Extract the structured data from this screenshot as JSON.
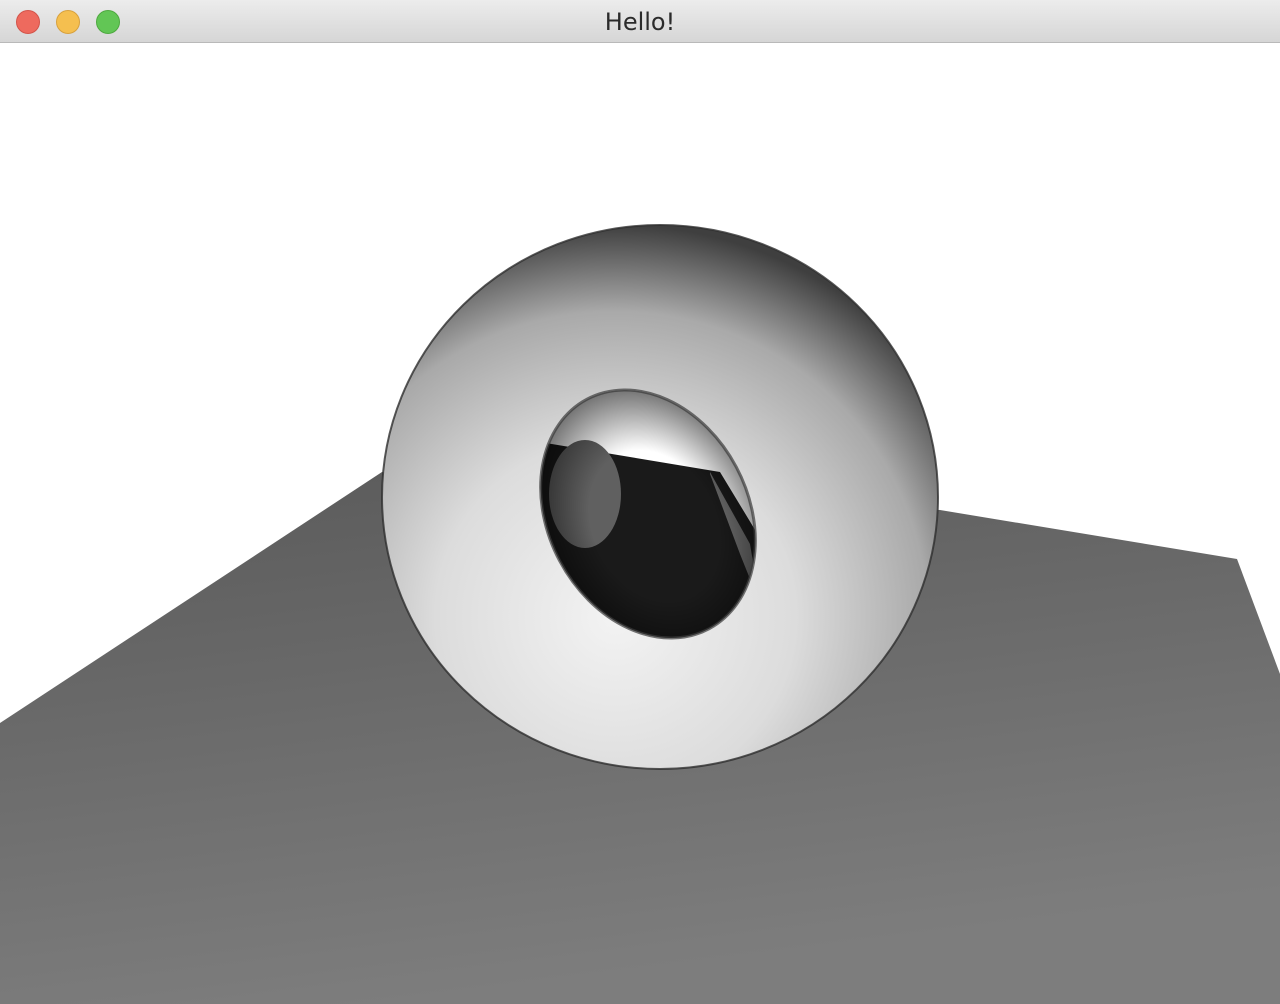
{
  "window": {
    "title": "Hello!"
  },
  "scene": {
    "background_color": "#ffffff",
    "floor_color": "#6a6a6a",
    "torus_highlight_color": "#f0f0f0",
    "torus_shadow_color": "#111111",
    "shadow_color": "#1a1a1a"
  }
}
